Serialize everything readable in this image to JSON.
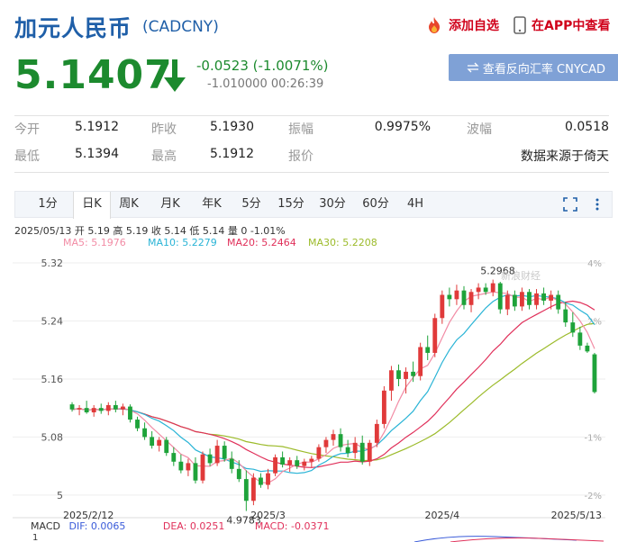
{
  "header": {
    "title": "加元人民币",
    "code": "(CADCNY)",
    "add_watch": "添加自选",
    "app_view": "在APP中查看"
  },
  "quote": {
    "price": "5.1407",
    "change": "-0.0523 (-1.0071%)",
    "sub": "-1.010000 00:26:39",
    "reverse_button": "查看反向汇率 CNYCAD",
    "direction": "down",
    "color": "#1c8a2e"
  },
  "stats": {
    "row1": [
      {
        "label": "今开",
        "value": "5.1912"
      },
      {
        "label": "昨收",
        "value": "5.1930"
      },
      {
        "label": "振幅",
        "value": "0.9975%"
      },
      {
        "label": "波幅",
        "value": "0.0518"
      }
    ],
    "row2": [
      {
        "label": "最低",
        "value": "5.1394"
      },
      {
        "label": "最高",
        "value": "5.1912"
      },
      {
        "label": "报价",
        "value": ""
      },
      {
        "label": "",
        "value": "数据来源于倚天"
      }
    ]
  },
  "tabs": [
    "1分",
    "日K",
    "周K",
    "月K",
    "年K",
    "5分",
    "15分",
    "30分",
    "60分",
    "4H"
  ],
  "active_tab": "日K",
  "info": {
    "line": "2025/05/13  开 5.19  高 5.19  收 5.14  低 5.14  量 0  -1.01%",
    "ma5": "MA5: 5.1976",
    "ma10": "MA10: 5.2279",
    "ma20": "MA20: 5.2464",
    "ma30": "MA30: 5.2208"
  },
  "colors": {
    "up": "#e03a3a",
    "down": "#1ea33a",
    "ma5": "#f28ca5",
    "ma10": "#2ab4d6",
    "ma20": "#e0305a",
    "ma30": "#9cbb2a"
  },
  "chart_data": {
    "type": "candlestick",
    "y_ticks_left": [
      "5.32",
      "5.24",
      "5.16",
      "5.08",
      "5"
    ],
    "y_ticks_right": [
      "4%",
      "2%",
      "-1%",
      "-2%"
    ],
    "ylim": [
      4.97,
      5.33
    ],
    "x_labels": [
      "2025/2/12",
      "2025/3",
      "2025/4",
      "2025/5/13"
    ],
    "annotations": [
      {
        "label": "5.2968"
      },
      {
        "label": "4.9783"
      }
    ],
    "watermark": "新浪财经",
    "candles": [
      [
        5.125,
        5.128,
        5.115,
        5.118
      ],
      [
        5.118,
        5.124,
        5.11,
        5.12
      ],
      [
        5.12,
        5.13,
        5.112,
        5.114
      ],
      [
        5.114,
        5.124,
        5.108,
        5.12
      ],
      [
        5.12,
        5.126,
        5.112,
        5.116
      ],
      [
        5.116,
        5.128,
        5.11,
        5.124
      ],
      [
        5.124,
        5.13,
        5.114,
        5.118
      ],
      [
        5.118,
        5.126,
        5.11,
        5.122
      ],
      [
        5.122,
        5.125,
        5.1,
        5.104
      ],
      [
        5.104,
        5.108,
        5.088,
        5.092
      ],
      [
        5.092,
        5.1,
        5.076,
        5.08
      ],
      [
        5.08,
        5.088,
        5.064,
        5.068
      ],
      [
        5.068,
        5.08,
        5.06,
        5.076
      ],
      [
        5.076,
        5.08,
        5.054,
        5.058
      ],
      [
        5.058,
        5.066,
        5.04,
        5.046
      ],
      [
        5.046,
        5.056,
        5.03,
        5.034
      ],
      [
        5.034,
        5.05,
        5.026,
        5.044
      ],
      [
        5.044,
        5.052,
        5.016,
        5.02
      ],
      [
        5.02,
        5.06,
        5.016,
        5.056
      ],
      [
        5.056,
        5.064,
        5.04,
        5.044
      ],
      [
        5.044,
        5.076,
        5.04,
        5.068
      ],
      [
        5.068,
        5.074,
        5.046,
        5.05
      ],
      [
        5.05,
        5.06,
        5.03,
        5.036
      ],
      [
        5.036,
        5.048,
        5.018,
        5.022
      ],
      [
        5.022,
        5.034,
        4.978,
        4.992
      ],
      [
        4.992,
        5.03,
        4.986,
        5.024
      ],
      [
        5.024,
        5.03,
        5.01,
        5.014
      ],
      [
        5.014,
        5.036,
        5.008,
        5.03
      ],
      [
        5.03,
        5.056,
        5.026,
        5.052
      ],
      [
        5.052,
        5.06,
        5.038,
        5.042
      ],
      [
        5.042,
        5.052,
        5.032,
        5.048
      ],
      [
        5.048,
        5.054,
        5.036,
        5.04
      ],
      [
        5.04,
        5.05,
        5.034,
        5.046
      ],
      [
        5.046,
        5.054,
        5.038,
        5.05
      ],
      [
        5.05,
        5.07,
        5.046,
        5.066
      ],
      [
        5.066,
        5.08,
        5.058,
        5.076
      ],
      [
        5.076,
        5.09,
        5.068,
        5.084
      ],
      [
        5.084,
        5.092,
        5.06,
        5.066
      ],
      [
        5.066,
        5.076,
        5.052,
        5.058
      ],
      [
        5.058,
        5.08,
        5.05,
        5.072
      ],
      [
        5.072,
        5.082,
        5.042,
        5.046
      ],
      [
        5.046,
        5.076,
        5.04,
        5.072
      ],
      [
        5.072,
        5.104,
        5.066,
        5.098
      ],
      [
        5.098,
        5.15,
        5.092,
        5.144
      ],
      [
        5.144,
        5.178,
        5.13,
        5.172
      ],
      [
        5.172,
        5.18,
        5.15,
        5.16
      ],
      [
        5.16,
        5.176,
        5.14,
        5.17
      ],
      [
        5.17,
        5.184,
        5.156,
        5.164
      ],
      [
        5.164,
        5.21,
        5.158,
        5.204
      ],
      [
        5.204,
        5.22,
        5.186,
        5.196
      ],
      [
        5.196,
        5.25,
        5.19,
        5.244
      ],
      [
        5.244,
        5.282,
        5.236,
        5.276
      ],
      [
        5.276,
        5.286,
        5.26,
        5.27
      ],
      [
        5.27,
        5.29,
        5.262,
        5.282
      ],
      [
        5.282,
        5.288,
        5.256,
        5.262
      ],
      [
        5.262,
        5.284,
        5.252,
        5.28
      ],
      [
        5.28,
        5.292,
        5.27,
        5.286
      ],
      [
        5.286,
        5.292,
        5.276,
        5.28
      ],
      [
        5.28,
        5.297,
        5.274,
        5.292
      ],
      [
        5.292,
        5.294,
        5.25,
        5.256
      ],
      [
        5.256,
        5.282,
        5.248,
        5.276
      ],
      [
        5.276,
        5.282,
        5.254,
        5.26
      ],
      [
        5.26,
        5.286,
        5.254,
        5.28
      ],
      [
        5.28,
        5.284,
        5.256,
        5.262
      ],
      [
        5.262,
        5.284,
        5.256,
        5.278
      ],
      [
        5.278,
        5.286,
        5.262,
        5.268
      ],
      [
        5.268,
        5.282,
        5.256,
        5.276
      ],
      [
        5.276,
        5.282,
        5.25,
        5.256
      ],
      [
        5.256,
        5.266,
        5.232,
        5.238
      ],
      [
        5.238,
        5.252,
        5.218,
        5.224
      ],
      [
        5.224,
        5.232,
        5.2,
        5.206
      ],
      [
        5.206,
        5.21,
        5.196,
        5.198
      ],
      [
        5.194,
        5.196,
        5.14,
        5.142
      ]
    ]
  },
  "macd": {
    "label": "MACD",
    "dif": "DIF: 0.0065",
    "dea": "DEA: 0.0251",
    "macd": "MACD: -0.0371",
    "tick": "1"
  }
}
